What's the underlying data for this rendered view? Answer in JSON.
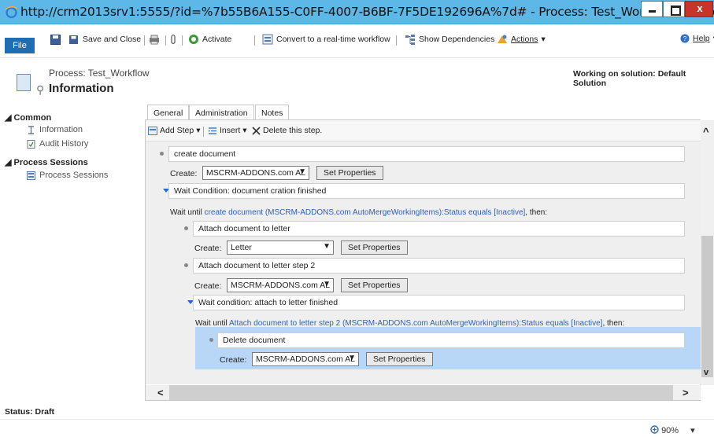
{
  "window": {
    "title": "http://crm2013srv1:5555/?id=%7b55B6A155-C0FF-4007-B6BF-7F5DE192696A%7d# - Process: Test_Workflo - Window...",
    "close_glyph": "x"
  },
  "ribbon": {
    "file": "File",
    "save_and_close": "Save and Close",
    "activate": "Activate",
    "convert": "Convert to a real-time workflow",
    "show_dependencies": "Show Dependencies",
    "actions": "Actions",
    "actions_arrow": "▾",
    "help": "Help",
    "help_arrow": "▾"
  },
  "header": {
    "process_name": "Process: Test_Workflow",
    "section": "Information",
    "solution": "Working on solution: Default Solution"
  },
  "nav": {
    "common": "Common",
    "items_common": [
      "Information",
      "Audit History"
    ],
    "process_sessions_group": "Process Sessions",
    "items_sessions": [
      "Process Sessions"
    ]
  },
  "tabs": [
    "General",
    "Administration",
    "Notes"
  ],
  "toolbar": {
    "add_step": "Add Step",
    "insert": "Insert",
    "delete": "Delete this step.",
    "dropdown_arrow": "▾"
  },
  "steps": {
    "create_label": "Create:",
    "set_properties": "Set Properties",
    "step1_name": "create document",
    "step1_entity": "MSCRM-ADDONS.com AL",
    "wait1_name": "Wait Condition: document cration finished",
    "wait1_prefix": "Wait until",
    "wait1_link": "create document (MSCRM-ADDONS.com AutoMergeWorkingItems):Status equals [Inactive]",
    "wait1_suffix": ", then:",
    "step2_name": "Attach document to letter",
    "step2_entity": "Letter",
    "step3_name": "Attach document to letter step 2",
    "step3_entity": "MSCRM-ADDONS.com AL",
    "wait2_name": "Wait condition: attach to letter finished",
    "wait2_prefix": "Wait until",
    "wait2_link": "Attach document to letter step 2 (MSCRM-ADDONS.com AutoMergeWorkingItems):Status equals [Inactive]",
    "wait2_suffix": ", then:",
    "step4_name": "Delete document",
    "step4_entity": "MSCRM-ADDONS.com AL",
    "select_arrow": "▼"
  },
  "scroll": {
    "up": "^",
    "down": "v",
    "left": "<",
    "right": ">"
  },
  "status": {
    "text": "Status: Draft",
    "zoom": "90%",
    "zoom_arrow": "▾"
  },
  "colors": {
    "titlebar": "#5db8e8",
    "file": "#1f6db3",
    "link": "#2d5fb8",
    "highlight": "#b8d6f5"
  }
}
